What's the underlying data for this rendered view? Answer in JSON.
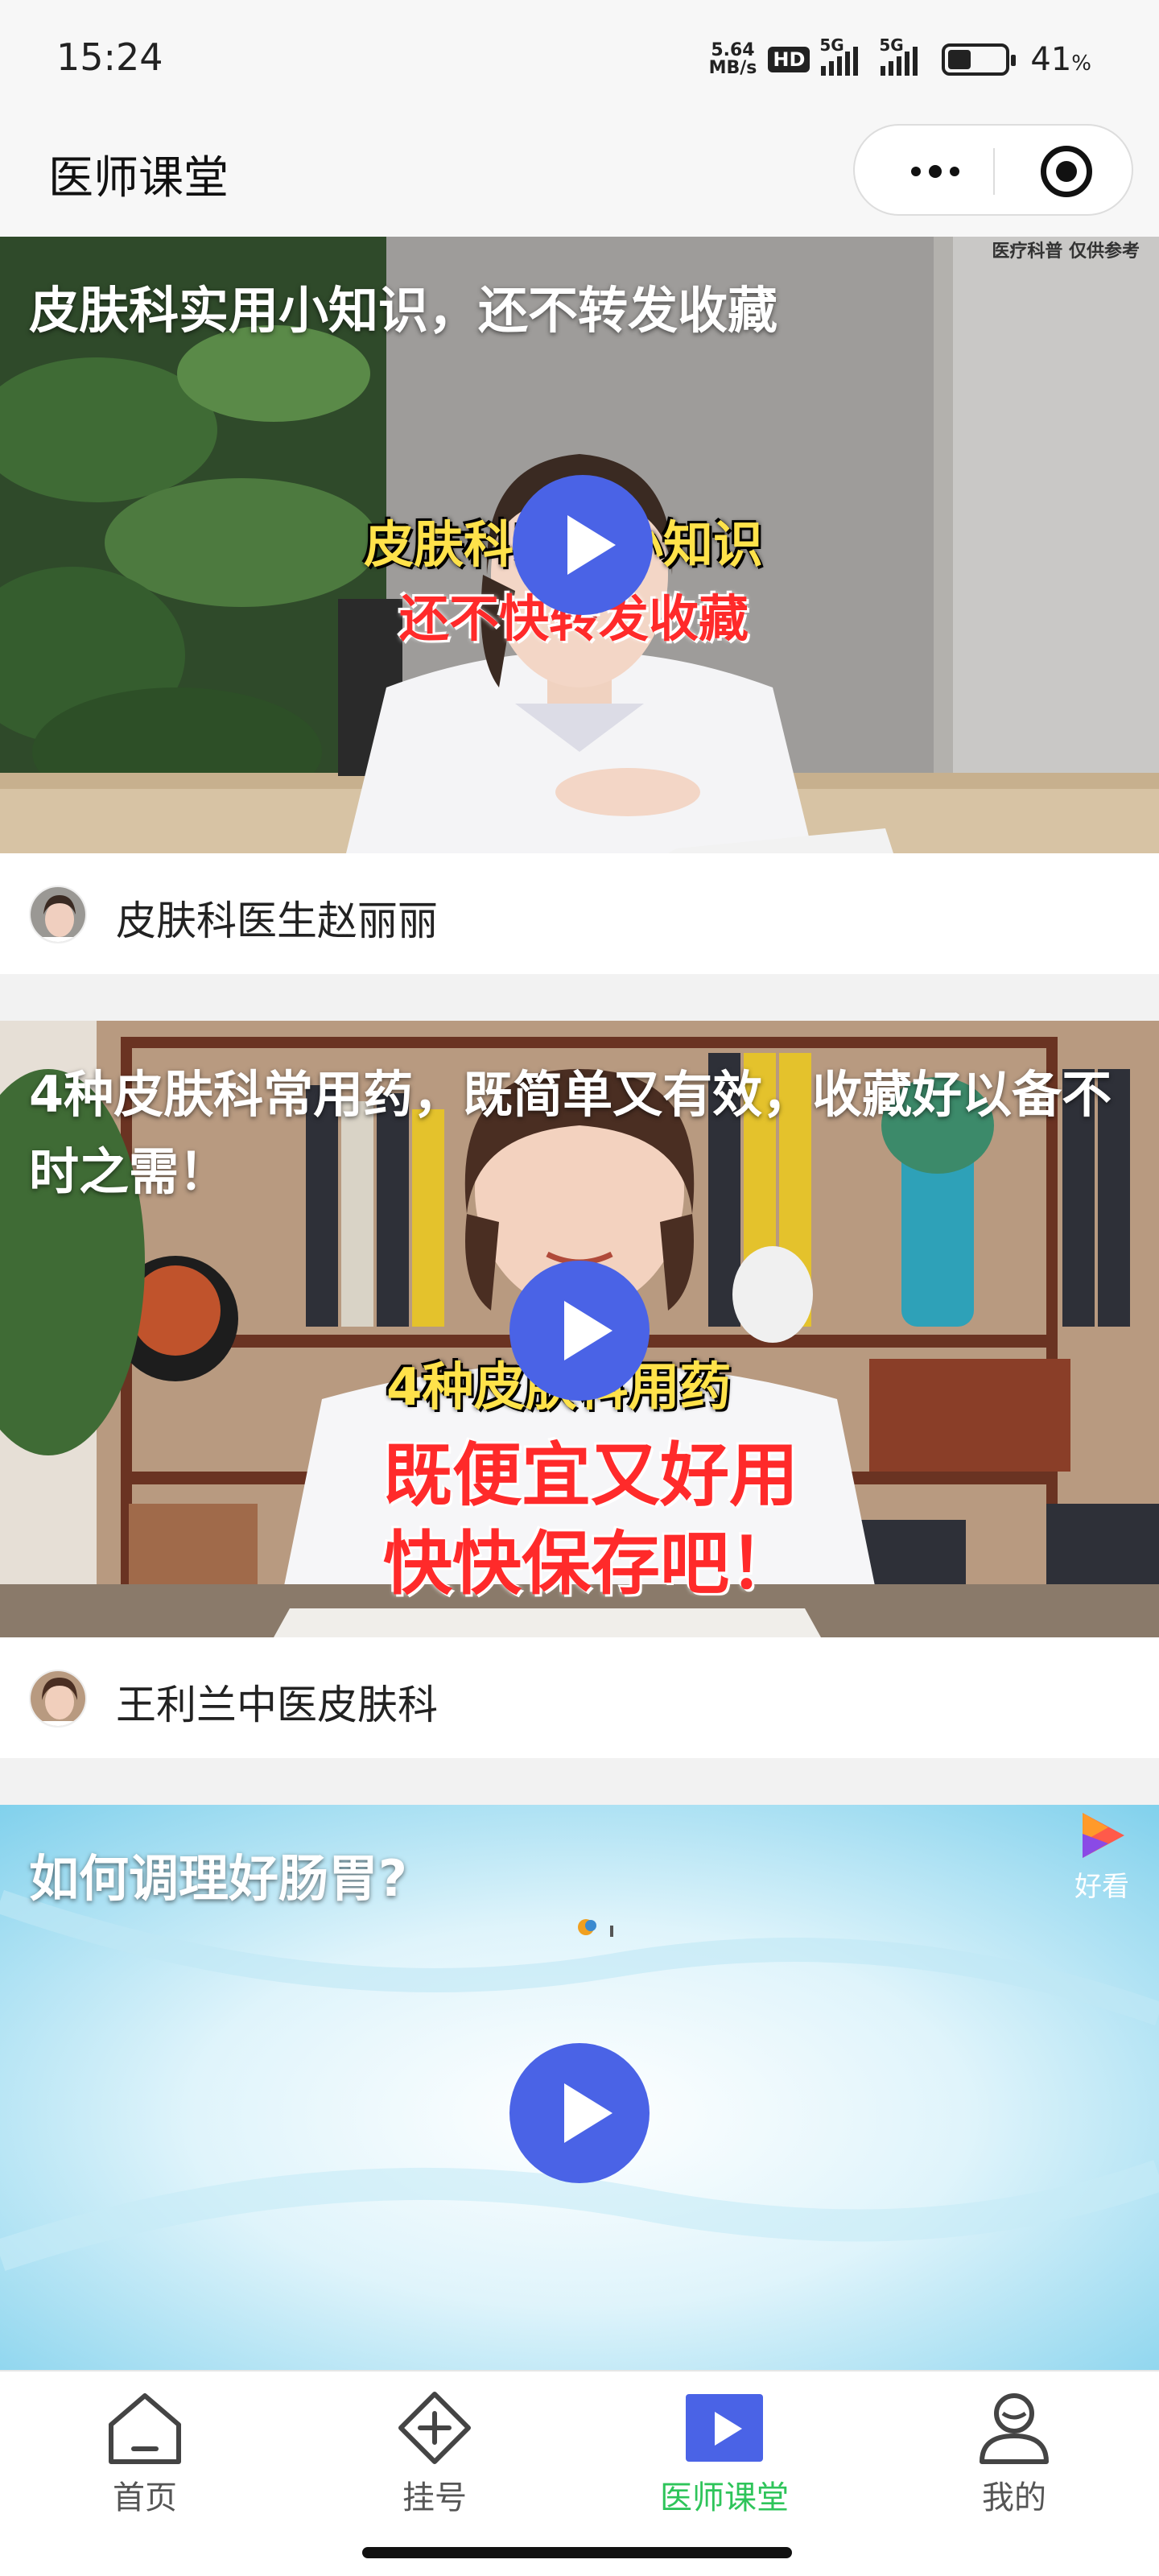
{
  "status_bar": {
    "time": "15:24",
    "net_speed_value": "5.64",
    "net_speed_unit": "MB/s",
    "hd": "HD",
    "network_1": "5G",
    "network_2": "5G",
    "battery_value": "41",
    "battery_unit": "%",
    "battery_level": 0.41
  },
  "header": {
    "title": "医师课堂",
    "more_icon": "more-dots-icon",
    "close_icon": "target-circle-icon"
  },
  "videos": [
    {
      "title": "皮肤科实用小知识，还不转发收藏",
      "corner_tag": "医疗科普 仅供参考",
      "subtitle_line1": "皮肤科实用小知识",
      "subtitle_line2": "还不快转发收藏",
      "author": "皮肤科医生赵丽丽"
    },
    {
      "title": "4种皮肤科常用药，既简单又有效，收藏好以备不时之需！",
      "subtitle_line1": "4种皮肤科用药",
      "subtitle_line2": "既便宜又好用",
      "subtitle_line3": "快快保存吧！",
      "author": "王利兰中医皮肤科"
    },
    {
      "title": "如何调理好肠胃?",
      "badge": "好看"
    }
  ],
  "tabs": [
    {
      "label": "首页",
      "icon": "home-icon"
    },
    {
      "label": "挂号",
      "icon": "plus-diamond-icon"
    },
    {
      "label": "医师课堂",
      "icon": "play-square-icon"
    },
    {
      "label": "我的",
      "icon": "user-icon"
    }
  ],
  "colors": {
    "play_button": "#4a63e6",
    "active_tab": "#2ec45a"
  }
}
